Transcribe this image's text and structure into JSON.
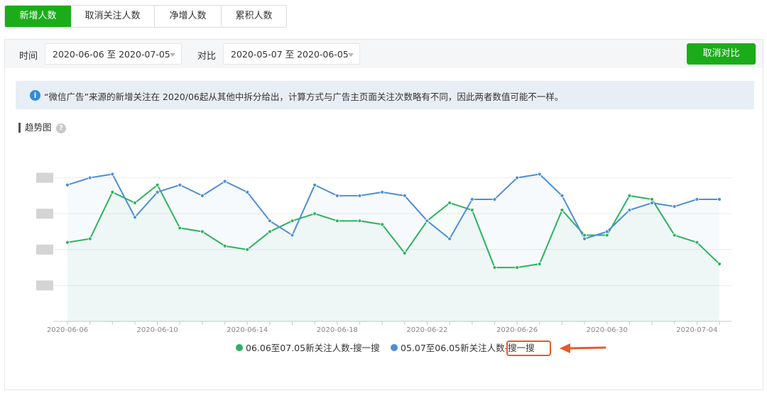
{
  "tabs": [
    {
      "label": "新增人数",
      "active": true
    },
    {
      "label": "取消关注人数",
      "active": false
    },
    {
      "label": "净增人数",
      "active": false
    },
    {
      "label": "累积人数",
      "active": false
    }
  ],
  "filters": {
    "time_label": "时间",
    "time_value": "2020-06-06 至 2020-07-05",
    "compare_label": "对比",
    "compare_value": "2020-05-07 至 2020-06-05",
    "cancel_compare": "取消对比"
  },
  "notice": "“微信广告”来源的新增关注在 2020/06起从其他中拆分给出，计算方式与广告主页面关注次数略有不同，因此两者数值可能不一样。",
  "trend_title": "趋势图",
  "colors": {
    "green": "#1aad19",
    "green_line": "#2bb35c",
    "blue": "#4d8ed6",
    "accent": "#e85a2a"
  },
  "chart_data": {
    "type": "line",
    "x_tick_labels": [
      "2020-06-06",
      "2020-06-10",
      "2020-06-14",
      "2020-06-18",
      "2020-06-22",
      "2020-06-26",
      "2020-06-30",
      "2020-07-04"
    ],
    "y_axis_values_visible": false,
    "ylim": [
      0,
      5
    ],
    "grid": true,
    "legend_position": "bottom-center",
    "series": [
      {
        "name": "06.06至07.05新关注人数-搜一搜",
        "color": "#2bb35c",
        "values": [
          2.2,
          2.3,
          3.6,
          3.3,
          3.8,
          2.6,
          2.5,
          2.1,
          2.0,
          2.5,
          2.8,
          3.0,
          2.8,
          2.8,
          2.7,
          1.9,
          2.8,
          3.3,
          3.1,
          1.5,
          1.5,
          1.6,
          3.1,
          2.4,
          2.4,
          3.5,
          3.4,
          2.4,
          2.2,
          1.6
        ]
      },
      {
        "name": "05.07至06.05新关注人数-搜一搜",
        "color": "#4d8ed6",
        "values": [
          3.8,
          4.0,
          4.1,
          2.9,
          3.6,
          3.8,
          3.5,
          3.9,
          3.6,
          2.8,
          2.4,
          3.8,
          3.5,
          3.5,
          3.6,
          3.5,
          2.8,
          2.3,
          3.4,
          3.4,
          4.0,
          4.1,
          3.5,
          2.3,
          2.5,
          3.1,
          3.3,
          3.2,
          3.4,
          3.4
        ]
      }
    ]
  }
}
